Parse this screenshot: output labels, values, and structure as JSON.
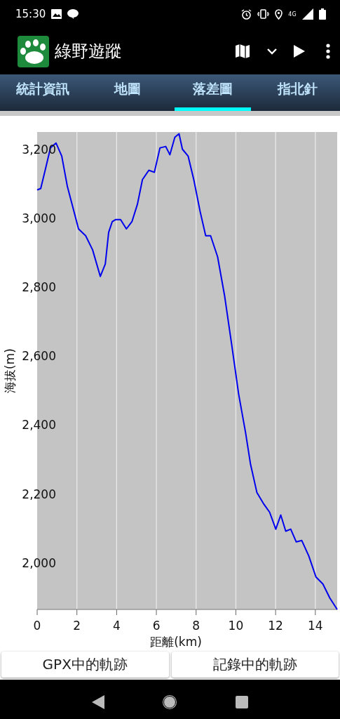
{
  "status_bar": {
    "time": "15:30",
    "network": "4G"
  },
  "app_bar": {
    "title": "綠野遊蹤"
  },
  "tabs": [
    {
      "label": "統計資訊",
      "selected": false
    },
    {
      "label": "地圖",
      "selected": false
    },
    {
      "label": "落差圖",
      "selected": true
    },
    {
      "label": "指北針",
      "selected": false
    }
  ],
  "chart": {
    "chart_data": {
      "type": "line",
      "grid": true,
      "xlabel": "距離(km)",
      "ylabel": "海拔(m)",
      "xlim": [
        0,
        15.1
      ],
      "ylim": [
        1865,
        3250
      ],
      "xticks": [
        0,
        2,
        4,
        6,
        8,
        10,
        12,
        14
      ],
      "yticks": [
        {
          "value": 2000,
          "label": "2,000"
        },
        {
          "value": 2200,
          "label": "2,200"
        },
        {
          "value": 2400,
          "label": "2,400"
        },
        {
          "value": 2600,
          "label": "2,600"
        },
        {
          "value": 2800,
          "label": "2,800"
        },
        {
          "value": 3000,
          "label": "3,000"
        },
        {
          "value": 3200,
          "label": "3,200"
        }
      ],
      "x": [
        0,
        0.18,
        0.42,
        0.67,
        0.95,
        1.24,
        1.52,
        1.8,
        2.08,
        2.44,
        2.79,
        3.18,
        3.43,
        3.6,
        3.78,
        3.96,
        4.2,
        4.49,
        4.77,
        5.05,
        5.3,
        5.62,
        5.9,
        6.18,
        6.47,
        6.68,
        6.93,
        7.14,
        7.31,
        7.6,
        7.88,
        8.2,
        8.48,
        8.73,
        9.08,
        9.43,
        9.79,
        10.14,
        10.49,
        10.74,
        11.06,
        11.38,
        11.7,
        12.01,
        12.26,
        12.51,
        12.76,
        13.04,
        13.32,
        13.67,
        14.03,
        14.38,
        14.73,
        15.1
      ],
      "series": [
        {
          "color": "#0000ee",
          "values": [
            3082,
            3086,
            3143,
            3204,
            3218,
            3180,
            3092,
            3031,
            2969,
            2949,
            2908,
            2831,
            2867,
            2959,
            2990,
            2996,
            2996,
            2969,
            2990,
            3041,
            3112,
            3139,
            3133,
            3204,
            3208,
            3184,
            3235,
            3245,
            3200,
            3180,
            3112,
            3020,
            2949,
            2949,
            2888,
            2776,
            2633,
            2490,
            2378,
            2286,
            2204,
            2173,
            2147,
            2098,
            2139,
            2092,
            2098,
            2061,
            2065,
            2020,
            1959,
            1939,
            1898,
            1865
          ]
        }
      ]
    }
  },
  "buttons": [
    {
      "label": "GPX中的軌跡"
    },
    {
      "label": "記錄中的軌跡"
    }
  ]
}
